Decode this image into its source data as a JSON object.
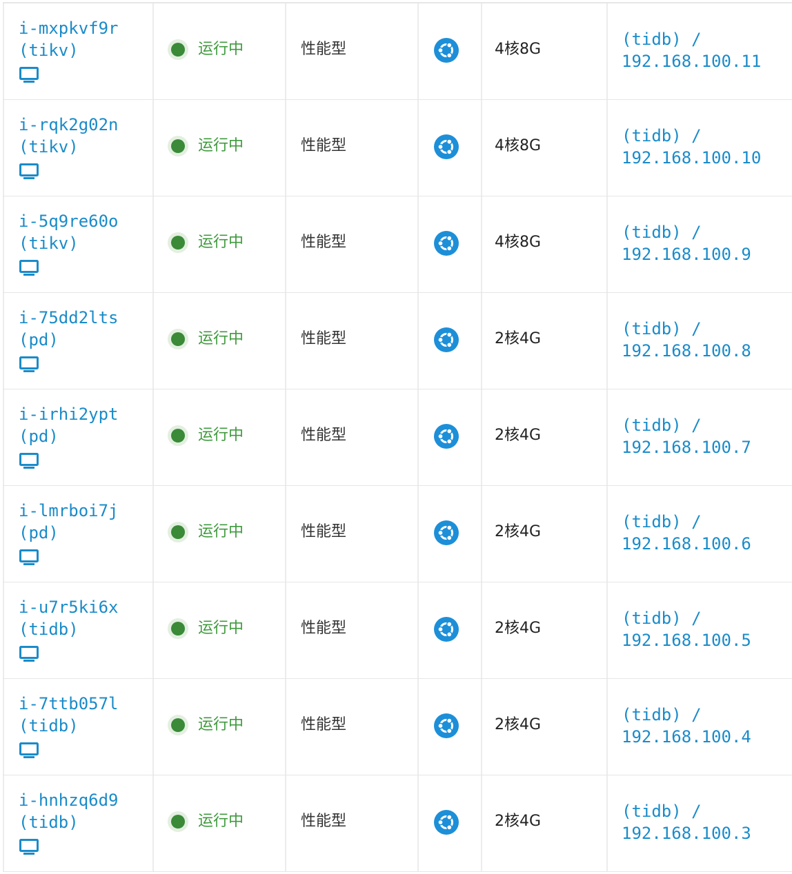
{
  "colors": {
    "link": "#1a8bc9",
    "status_running": "#3f9a3d",
    "os_icon": "#1d8fd8"
  },
  "icons": {
    "console": "monitor-icon",
    "os": "ubuntu-icon",
    "status": "status-dot-icon"
  },
  "rows": [
    {
      "id": "i-mxpkvf9r",
      "role": "(tikv)",
      "status": "运行中",
      "type": "性能型",
      "config": "4核8G",
      "vxnet": "(tidb) /",
      "ip": "192.168.100.11"
    },
    {
      "id": "i-rqk2g02n",
      "role": "(tikv)",
      "status": "运行中",
      "type": "性能型",
      "config": "4核8G",
      "vxnet": "(tidb) /",
      "ip": "192.168.100.10"
    },
    {
      "id": "i-5q9re60o",
      "role": "(tikv)",
      "status": "运行中",
      "type": "性能型",
      "config": "4核8G",
      "vxnet": "(tidb) /",
      "ip": "192.168.100.9"
    },
    {
      "id": "i-75dd2lts",
      "role": "(pd)",
      "status": "运行中",
      "type": "性能型",
      "config": "2核4G",
      "vxnet": "(tidb) /",
      "ip": "192.168.100.8"
    },
    {
      "id": "i-irhi2ypt",
      "role": "(pd)",
      "status": "运行中",
      "type": "性能型",
      "config": "2核4G",
      "vxnet": "(tidb) /",
      "ip": "192.168.100.7"
    },
    {
      "id": "i-lmrboi7j",
      "role": "(pd)",
      "status": "运行中",
      "type": "性能型",
      "config": "2核4G",
      "vxnet": "(tidb) /",
      "ip": "192.168.100.6"
    },
    {
      "id": "i-u7r5ki6x",
      "role": "(tidb)",
      "status": "运行中",
      "type": "性能型",
      "config": "2核4G",
      "vxnet": "(tidb) /",
      "ip": "192.168.100.5"
    },
    {
      "id": "i-7ttb057l",
      "role": "(tidb)",
      "status": "运行中",
      "type": "性能型",
      "config": "2核4G",
      "vxnet": "(tidb) /",
      "ip": "192.168.100.4"
    },
    {
      "id": "i-hnhzq6d9",
      "role": "(tidb)",
      "status": "运行中",
      "type": "性能型",
      "config": "2核4G",
      "vxnet": "(tidb) /",
      "ip": "192.168.100.3"
    }
  ]
}
